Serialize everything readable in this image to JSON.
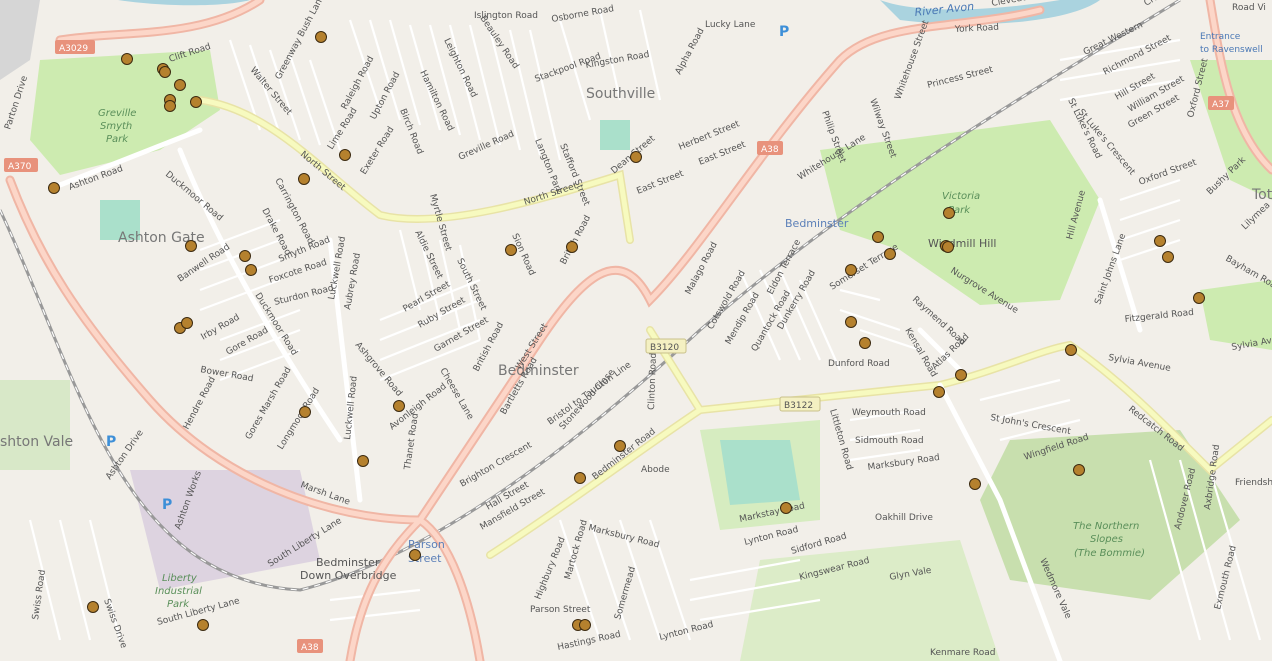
{
  "places": {
    "southville": "Southville",
    "ashton_gate": "Ashton Gate",
    "bedminster": "Bedminster",
    "bedminster_station": "Bedminster",
    "ashton_vale": "shton Vale",
    "tot": "Tot",
    "parson_street_station_1": "Parson",
    "parson_street_station_2": "Street"
  },
  "parks": {
    "greville_1": "Greville",
    "greville_2": "Smyth",
    "greville_3": "Park",
    "victoria_1": "Victoria",
    "victoria_2": "Park",
    "bommie_1": "The Northern",
    "bommie_2": "Slopes",
    "bommie_3": "(The Bommie)",
    "liberty_1": "Liberty",
    "liberty_2": "Industrial",
    "liberty_3": "Park"
  },
  "water": {
    "river_avon": "River Avon"
  },
  "road_refs": {
    "a3029": "A3029",
    "a370": "A370",
    "a38_north": "A38",
    "a37": "A37",
    "b3120": "B3120",
    "b3122": "B3122",
    "a38_south": "A38"
  },
  "poi": {
    "entrance_1": "Entrance",
    "entrance_2": "to Ravenswell",
    "road_vi": "Road Vi",
    "bedminster_down_1": "Bedminster",
    "bedminster_down_2": "Down Overbridge",
    "abode": "Abode",
    "windmill_hill": "Windmill Hill",
    "parking": "P"
  },
  "streets": {
    "north_street_1": "North Street",
    "north_street_2": "North Street",
    "west_street": "West Street",
    "bedminster_road": "Bedminster Road",
    "malago_road": "Malago Road",
    "redcatch_road": "Redcatch Road",
    "duckmoor_road_1": "Duckmoor Road",
    "duckmoor_road_2": "Duckmoor Road",
    "ashton_road": "Ashton Road",
    "luckwell_road_1": "Luckwell Road",
    "luckwell_road_2": "Luckwell Road",
    "islington_road": "Islington Road",
    "osborne_road": "Osborne Road",
    "lucky_lane": "Lucky Lane",
    "york_road": "York Road",
    "clift_road": "Clift Road",
    "parton_drive": "Parton Drive",
    "walter_street": "Walter Street",
    "greenway_bush_lane": "Greenway Bush Lane",
    "raleigh_road": "Raleigh Road",
    "upton_road": "Upton Road",
    "birch_road": "Birch Road",
    "hamilton_road": "Hamilton Road",
    "leighton_road": "Leighton Road",
    "beauley_road": "Beauley Road",
    "stackpool_road": "Stackpool Road",
    "kingston_road": "Kingston Road",
    "alpha_road": "Alpha Road",
    "lime_road": "Lime Road",
    "exeter_road": "Exeter Road",
    "greville_road": "Greville Road",
    "myrtle_street": "Myrtle Street",
    "carrington_road": "Carrington Road",
    "drake_road": "Drake Road",
    "smyth_road": "Smyth Road",
    "foxcote_road": "Foxcote Road",
    "sturdon_road": "Sturdon Road",
    "banwell_road": "Banwell Road",
    "irby_road": "Irby Road",
    "gore_road": "Gore Road",
    "bower_road": "Bower Road",
    "hendre_road": "Hendre Road",
    "ashton_drive": "Ashton Drive",
    "ashton_works": "Ashton Works",
    "gores_marsh_road": "Gores Marsh Road",
    "longmoor_road": "Longmoor Road",
    "marsh_lane": "Marsh Lane",
    "south_liberty_lane_1": "South Liberty Lane",
    "south_liberty_lane_2": "South Liberty Lane",
    "swiss_road": "Swiss Road",
    "swiss_drive": "Swiss Drive",
    "pearl_street": "Pearl Street",
    "ruby_street": "Ruby Street",
    "garnet_street": "Garnet Street",
    "cheese_lane": "Cheese Lane",
    "avonleigh_road": "Avonleigh Road",
    "thanet_road": "Thanet Road",
    "brighton_crescent": "Brighton Crescent",
    "hall_street": "Hall Street",
    "mansfield_street": "Mansfield Street",
    "highbury_road": "Highbury Road",
    "martock_road": "Martock Road",
    "somermead": "Somermead",
    "parson_street": "Parson Street",
    "hastings_road": "Hastings Road",
    "bartletts_road": "Bartletts Road",
    "stonewood_close": "Stonewood Close",
    "clinton_road": "Clinton Road",
    "marksbury_road_1": "Marksbury Road",
    "marksbury_road_2": "Marksbury Road",
    "markstay_road": "Markstay Road",
    "lynton_road_1": "Lynton Road",
    "lynton_road_2": "Lynton Road",
    "sidford_road": "Sidford Road",
    "kingswear_road": "Kingswear Road",
    "oakhill_drive": "Oakhill Drive",
    "glyn_vale": "Glyn Vale",
    "kenmare_road": "Kenmare Road",
    "weymouth_road": "Weymouth Road",
    "sidmouth_road": "Sidmouth Road",
    "littleton_road": "Littleton Road",
    "st_johns_crescent": "St John's Crescent",
    "wingfield_road": "Wingfield Road",
    "wedmore_vale": "Wedmore Vale",
    "exmouth_road": "Exmouth Road",
    "andover_road": "Andover Road",
    "axbridge_road": "Axbridge Road",
    "friendship": "Friendship",
    "sylvia_avenue_1": "Sylvia Avenue",
    "sylvia_avenue_2": "Sylvia Avenue",
    "fitzgerald_road": "Fitzgerald Road",
    "saint_johns_lane": "Saint Johns Lane",
    "hill_avenue": "Hill Avenue",
    "nurgrove_avenue": "Nurgrove Avenue",
    "raymend_road": "Raymend Road",
    "kensal_road": "Kensal Road",
    "atlas_road": "Atlas Road",
    "dunford_road": "Dunford Road",
    "dunkerry_road": "Dunkerry Road",
    "quantock_road": "Quantock Road",
    "mendip_road": "Mendip Road",
    "cotswold_road": "Cotswold Road",
    "eldon_terrace": "Eldon Terrace",
    "somerset_terrace": "Somerset Terrace",
    "whitehouse_lane": "Whitehouse Lane",
    "whitehouse_street": "Whitehouse Street",
    "philip_street": "Philip Street",
    "wilway_street": "Wilway Street",
    "princess_street": "Princess Street",
    "herbert_street": "Herbert Street",
    "east_street_1": "East Street",
    "east_street_2": "East Street",
    "dean_street": "Dean Street",
    "langton_park": "Langton Park",
    "stafford_street": "Stafford Street",
    "sion_road": "Sion Road",
    "british_road_1": "British Road",
    "british_road_2": "British Road",
    "aldie_street": "Aldie Street",
    "south_street": "South Street",
    "ashgrove_road": "Ashgrove Road",
    "aubrey_road": "Aubrey Road",
    "bristol_taunton_line": "Bristol to Taunton Line",
    "richmond_street": "Richmond Street",
    "hill_street": "Hill Street",
    "william_street": "William Street",
    "green_street": "Green Street",
    "oxford_street_1": "Oxford Street",
    "oxford_street_2": "Oxford Street",
    "st_lukes_road": "St Luke's Road",
    "st_lukes_crescent": "St Luke's Crescent",
    "great_western": "Great Western",
    "bushy_park": "Bushy Park",
    "bayham_road": "Bayham Road",
    "lilymead": "Lilymea",
    "cleveland": "Clevedon",
    "cromwell": "Cromwell"
  },
  "markers": {
    "count": 56,
    "color": "#b5812e",
    "stroke": "#3c2a10"
  }
}
